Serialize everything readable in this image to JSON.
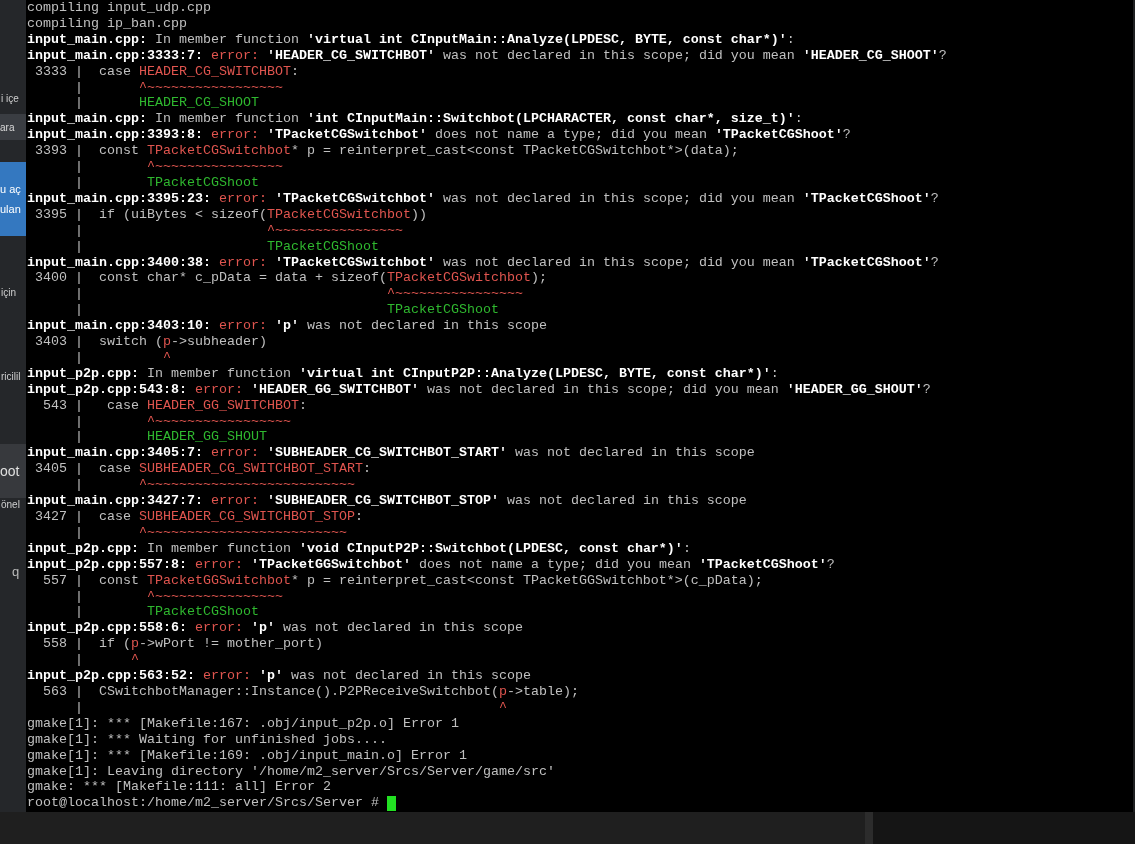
{
  "side_strip": [
    {
      "kind": "text",
      "texts": [
        "i içe"
      ]
    },
    {
      "kind": "box",
      "texts": [
        "ara"
      ]
    },
    {
      "kind": "blue",
      "texts": [
        "u aç",
        "ulan"
      ]
    },
    {
      "kind": "text",
      "texts": [
        "için"
      ]
    },
    {
      "kind": "text",
      "texts": [
        "ricilil"
      ]
    },
    {
      "kind": "panel",
      "texts": [
        "oot"
      ]
    },
    {
      "kind": "text",
      "texts": [
        "önel"
      ]
    },
    {
      "kind": "big",
      "texts": [
        "q"
      ]
    }
  ],
  "terminal": {
    "cursor": true,
    "lines": [
      [
        {
          "kind": "plain",
          "text": "compiling input_udp.cpp"
        }
      ],
      [
        {
          "kind": "plain",
          "text": "compiling ip_ban.cpp"
        }
      ],
      [
        {
          "kind": "bold",
          "text": "input_main.cpp:"
        },
        {
          "kind": "plain",
          "text": " In member function "
        },
        {
          "kind": "bold",
          "text": "'virtual int CInputMain::Analyze(LPDESC, BYTE, const char*)'"
        },
        {
          "kind": "plain",
          "text": ":"
        }
      ],
      [
        {
          "kind": "bold",
          "text": "input_main.cpp:3333:7:"
        },
        {
          "kind": "red",
          "text": " error: "
        },
        {
          "kind": "bold",
          "text": "'HEADER_CG_SWITCHBOT'"
        },
        {
          "kind": "plain",
          "text": " was not declared in this scope; did you mean "
        },
        {
          "kind": "bold",
          "text": "'HEADER_CG_SHOOT'"
        },
        {
          "kind": "plain",
          "text": "?"
        }
      ],
      [
        {
          "kind": "plain",
          "text": " 3333 |  case "
        },
        {
          "kind": "red",
          "text": "HEADER_CG_SWITCHBOT"
        },
        {
          "kind": "plain",
          "text": ":"
        }
      ],
      [
        {
          "kind": "plain",
          "text": "      |       "
        },
        {
          "kind": "red",
          "text": "^~~~~~~~~~~~~~~~~~"
        }
      ],
      [
        {
          "kind": "plain",
          "text": "      |       "
        },
        {
          "kind": "green",
          "text": "HEADER_CG_SHOOT"
        }
      ],
      [
        {
          "kind": "bold",
          "text": "input_main.cpp:"
        },
        {
          "kind": "plain",
          "text": " In member function "
        },
        {
          "kind": "bold",
          "text": "'int CInputMain::Switchbot(LPCHARACTER, const char*, size_t)'"
        },
        {
          "kind": "plain",
          "text": ":"
        }
      ],
      [
        {
          "kind": "bold",
          "text": "input_main.cpp:3393:8:"
        },
        {
          "kind": "red",
          "text": " error: "
        },
        {
          "kind": "bold",
          "text": "'TPacketCGSwitchbot'"
        },
        {
          "kind": "plain",
          "text": " does not name a type; did you mean "
        },
        {
          "kind": "bold",
          "text": "'TPacketCGShoot'"
        },
        {
          "kind": "plain",
          "text": "?"
        }
      ],
      [
        {
          "kind": "plain",
          "text": " 3393 |  const "
        },
        {
          "kind": "red",
          "text": "TPacketCGSwitchbot"
        },
        {
          "kind": "plain",
          "text": "* p = reinterpret_cast<const TPacketCGSwitchbot*>(data);"
        }
      ],
      [
        {
          "kind": "plain",
          "text": "      |        "
        },
        {
          "kind": "red",
          "text": "^~~~~~~~~~~~~~~~~"
        }
      ],
      [
        {
          "kind": "plain",
          "text": "      |        "
        },
        {
          "kind": "green",
          "text": "TPacketCGShoot"
        }
      ],
      [
        {
          "kind": "bold",
          "text": "input_main.cpp:3395:23:"
        },
        {
          "kind": "red",
          "text": " error: "
        },
        {
          "kind": "bold",
          "text": "'TPacketCGSwitchbot'"
        },
        {
          "kind": "plain",
          "text": " was not declared in this scope; did you mean "
        },
        {
          "kind": "bold",
          "text": "'TPacketCGShoot'"
        },
        {
          "kind": "plain",
          "text": "?"
        }
      ],
      [
        {
          "kind": "plain",
          "text": " 3395 |  if (uiBytes < sizeof("
        },
        {
          "kind": "red",
          "text": "TPacketCGSwitchbot"
        },
        {
          "kind": "plain",
          "text": "))"
        }
      ],
      [
        {
          "kind": "plain",
          "text": "      |                       "
        },
        {
          "kind": "red",
          "text": "^~~~~~~~~~~~~~~~~"
        }
      ],
      [
        {
          "kind": "plain",
          "text": "      |                       "
        },
        {
          "kind": "green",
          "text": "TPacketCGShoot"
        }
      ],
      [
        {
          "kind": "bold",
          "text": "input_main.cpp:3400:38:"
        },
        {
          "kind": "red",
          "text": " error: "
        },
        {
          "kind": "bold",
          "text": "'TPacketCGSwitchbot'"
        },
        {
          "kind": "plain",
          "text": " was not declared in this scope; did you mean "
        },
        {
          "kind": "bold",
          "text": "'TPacketCGShoot'"
        },
        {
          "kind": "plain",
          "text": "?"
        }
      ],
      [
        {
          "kind": "plain",
          "text": " 3400 |  const char* c_pData = data + sizeof("
        },
        {
          "kind": "red",
          "text": "TPacketCGSwitchbot"
        },
        {
          "kind": "plain",
          "text": ");"
        }
      ],
      [
        {
          "kind": "plain",
          "text": "      |                                      "
        },
        {
          "kind": "red",
          "text": "^~~~~~~~~~~~~~~~~"
        }
      ],
      [
        {
          "kind": "plain",
          "text": "      |                                      "
        },
        {
          "kind": "green",
          "text": "TPacketCGShoot"
        }
      ],
      [
        {
          "kind": "bold",
          "text": "input_main.cpp:3403:10:"
        },
        {
          "kind": "red",
          "text": " error: "
        },
        {
          "kind": "bold",
          "text": "'p'"
        },
        {
          "kind": "plain",
          "text": " was not declared in this scope"
        }
      ],
      [
        {
          "kind": "plain",
          "text": " 3403 |  switch ("
        },
        {
          "kind": "red",
          "text": "p"
        },
        {
          "kind": "plain",
          "text": "->subheader)"
        }
      ],
      [
        {
          "kind": "plain",
          "text": "      |          "
        },
        {
          "kind": "red",
          "text": "^"
        }
      ],
      [
        {
          "kind": "bold",
          "text": "input_p2p.cpp:"
        },
        {
          "kind": "plain",
          "text": " In member function "
        },
        {
          "kind": "bold",
          "text": "'virtual int CInputP2P::Analyze(LPDESC, BYTE, const char*)'"
        },
        {
          "kind": "plain",
          "text": ":"
        }
      ],
      [
        {
          "kind": "bold",
          "text": "input_p2p.cpp:543:8:"
        },
        {
          "kind": "red",
          "text": " error: "
        },
        {
          "kind": "bold",
          "text": "'HEADER_GG_SWITCHBOT'"
        },
        {
          "kind": "plain",
          "text": " was not declared in this scope; did you mean "
        },
        {
          "kind": "bold",
          "text": "'HEADER_GG_SHOUT'"
        },
        {
          "kind": "plain",
          "text": "?"
        }
      ],
      [
        {
          "kind": "plain",
          "text": "  543 |   case "
        },
        {
          "kind": "red",
          "text": "HEADER_GG_SWITCHBOT"
        },
        {
          "kind": "plain",
          "text": ":"
        }
      ],
      [
        {
          "kind": "plain",
          "text": "      |        "
        },
        {
          "kind": "red",
          "text": "^~~~~~~~~~~~~~~~~~"
        }
      ],
      [
        {
          "kind": "plain",
          "text": "      |        "
        },
        {
          "kind": "green",
          "text": "HEADER_GG_SHOUT"
        }
      ],
      [
        {
          "kind": "bold",
          "text": "input_main.cpp:3405:7:"
        },
        {
          "kind": "red",
          "text": " error: "
        },
        {
          "kind": "bold",
          "text": "'SUBHEADER_CG_SWITCHBOT_START'"
        },
        {
          "kind": "plain",
          "text": " was not declared in this scope"
        }
      ],
      [
        {
          "kind": "plain",
          "text": " 3405 |  case "
        },
        {
          "kind": "red",
          "text": "SUBHEADER_CG_SWITCHBOT_START"
        },
        {
          "kind": "plain",
          "text": ":"
        }
      ],
      [
        {
          "kind": "plain",
          "text": "      |       "
        },
        {
          "kind": "red",
          "text": "^~~~~~~~~~~~~~~~~~~~~~~~~~~"
        }
      ],
      [
        {
          "kind": "bold",
          "text": "input_main.cpp:3427:7:"
        },
        {
          "kind": "red",
          "text": " error: "
        },
        {
          "kind": "bold",
          "text": "'SUBHEADER_CG_SWITCHBOT_STOP'"
        },
        {
          "kind": "plain",
          "text": " was not declared in this scope"
        }
      ],
      [
        {
          "kind": "plain",
          "text": " 3427 |  case "
        },
        {
          "kind": "red",
          "text": "SUBHEADER_CG_SWITCHBOT_STOP"
        },
        {
          "kind": "plain",
          "text": ":"
        }
      ],
      [
        {
          "kind": "plain",
          "text": "      |       "
        },
        {
          "kind": "red",
          "text": "^~~~~~~~~~~~~~~~~~~~~~~~~~"
        }
      ],
      [
        {
          "kind": "bold",
          "text": "input_p2p.cpp:"
        },
        {
          "kind": "plain",
          "text": " In member function "
        },
        {
          "kind": "bold",
          "text": "'void CInputP2P::Switchbot(LPDESC, const char*)'"
        },
        {
          "kind": "plain",
          "text": ":"
        }
      ],
      [
        {
          "kind": "bold",
          "text": "input_p2p.cpp:557:8:"
        },
        {
          "kind": "red",
          "text": " error: "
        },
        {
          "kind": "bold",
          "text": "'TPacketGGSwitchbot'"
        },
        {
          "kind": "plain",
          "text": " does not name a type; did you mean "
        },
        {
          "kind": "bold",
          "text": "'TPacketCGShoot'"
        },
        {
          "kind": "plain",
          "text": "?"
        }
      ],
      [
        {
          "kind": "plain",
          "text": "  557 |  const "
        },
        {
          "kind": "red",
          "text": "TPacketGGSwitchbot"
        },
        {
          "kind": "plain",
          "text": "* p = reinterpret_cast<const TPacketGGSwitchbot*>(c_pData);"
        }
      ],
      [
        {
          "kind": "plain",
          "text": "      |        "
        },
        {
          "kind": "red",
          "text": "^~~~~~~~~~~~~~~~~"
        }
      ],
      [
        {
          "kind": "plain",
          "text": "      |        "
        },
        {
          "kind": "green",
          "text": "TPacketCGShoot"
        }
      ],
      [
        {
          "kind": "bold",
          "text": "input_p2p.cpp:558:6:"
        },
        {
          "kind": "red",
          "text": " error: "
        },
        {
          "kind": "bold",
          "text": "'p'"
        },
        {
          "kind": "plain",
          "text": " was not declared in this scope"
        }
      ],
      [
        {
          "kind": "plain",
          "text": "  558 |  if ("
        },
        {
          "kind": "red",
          "text": "p"
        },
        {
          "kind": "plain",
          "text": "->wPort != mother_port)"
        }
      ],
      [
        {
          "kind": "plain",
          "text": "      |      "
        },
        {
          "kind": "red",
          "text": "^"
        }
      ],
      [
        {
          "kind": "bold",
          "text": "input_p2p.cpp:563:52:"
        },
        {
          "kind": "red",
          "text": " error: "
        },
        {
          "kind": "bold",
          "text": "'p'"
        },
        {
          "kind": "plain",
          "text": " was not declared in this scope"
        }
      ],
      [
        {
          "kind": "plain",
          "text": "  563 |  CSwitchbotManager::Instance().P2PReceiveSwitchbot("
        },
        {
          "kind": "red",
          "text": "p"
        },
        {
          "kind": "plain",
          "text": "->table);"
        }
      ],
      [
        {
          "kind": "plain",
          "text": "      |                                                    "
        },
        {
          "kind": "red",
          "text": "^"
        }
      ],
      [
        {
          "kind": "plain",
          "text": "gmake[1]: *** [Makefile:167: .obj/input_p2p.o] Error 1"
        }
      ],
      [
        {
          "kind": "plain",
          "text": "gmake[1]: *** Waiting for unfinished jobs...."
        }
      ],
      [
        {
          "kind": "plain",
          "text": "gmake[1]: *** [Makefile:169: .obj/input_main.o] Error 1"
        }
      ],
      [
        {
          "kind": "plain",
          "text": "gmake[1]: Leaving directory '/home/m2_server/Srcs/Server/game/src'"
        }
      ],
      [
        {
          "kind": "plain",
          "text": "gmake: *** [Makefile:111: all] Error 2"
        }
      ],
      [
        {
          "kind": "plain",
          "text": "root@localhost:/home/m2_server/Srcs/Server # "
        }
      ]
    ]
  }
}
